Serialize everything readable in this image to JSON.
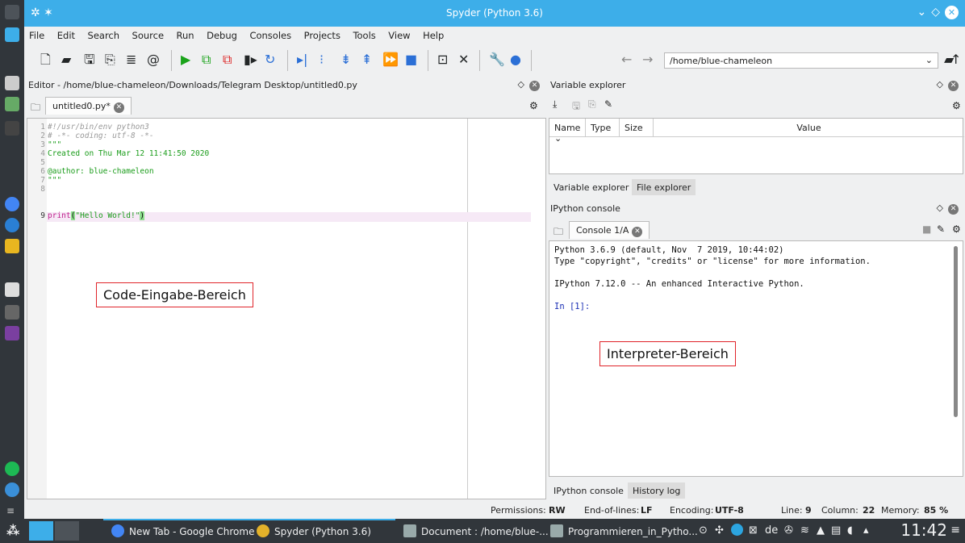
{
  "window": {
    "title": "Spyder (Python 3.6)"
  },
  "menu": [
    "File",
    "Edit",
    "Search",
    "Source",
    "Run",
    "Debug",
    "Consoles",
    "Projects",
    "Tools",
    "View",
    "Help"
  ],
  "toolbar": {
    "path": "/home/blue-chameleon"
  },
  "editor": {
    "header": "Editor - /home/blue-chameleon/Downloads/Telegram Desktop/untitled0.py",
    "tab": "untitled0.py*",
    "lines": [
      {
        "n": "1",
        "text": "#!/usr/bin/env python3"
      },
      {
        "n": "2",
        "text": "# -*- coding: utf-8 -*-"
      },
      {
        "n": "3",
        "text": "\"\"\""
      },
      {
        "n": "4",
        "text": "Created on Thu Mar 12 11:41:50 2020"
      },
      {
        "n": "5",
        "text": ""
      },
      {
        "n": "6",
        "text": "@author: blue-chameleon"
      },
      {
        "n": "7",
        "text": "\"\"\""
      },
      {
        "n": "8",
        "text": ""
      },
      {
        "n": "9",
        "text": "print(\"Hello World!\")"
      }
    ],
    "annotation": "Code-Eingabe-Bereich"
  },
  "varexp": {
    "header": "Variable explorer",
    "columns": [
      "Name",
      "Type",
      "Size",
      "Value"
    ],
    "tabs": [
      "Variable explorer",
      "File explorer"
    ]
  },
  "console": {
    "header": "IPython console",
    "tab": "Console 1/A",
    "lines": [
      "Python 3.6.9 (default, Nov  7 2019, 10:44:02)",
      "Type \"copyright\", \"credits\" or \"license\" for more information.",
      "",
      "IPython 7.12.0 -- An enhanced Interactive Python.",
      "",
      "In [1]:"
    ],
    "annotation": "Interpreter-Bereich",
    "tabs": [
      "IPython console",
      "History log"
    ]
  },
  "status": {
    "permissions_label": "Permissions:",
    "permissions": "RW",
    "eol_label": "End-of-lines:",
    "eol": "LF",
    "encoding_label": "Encoding:",
    "encoding": "UTF-8",
    "line_label": "Line:",
    "line": "9",
    "column_label": "Column:",
    "column": "22",
    "memory_label": "Memory:",
    "memory": "85 %"
  },
  "taskbar": {
    "tasks": [
      "New Tab - Google Chrome",
      "Spyder (Python 3.6)",
      "Document : /home/blue-...",
      "Programmieren_in_Pytho..."
    ],
    "lang": "de",
    "clock": "11:42"
  },
  "colors": {
    "accent": "#3daee9",
    "annotation_border": "#e0242a",
    "taskbar": "#31363b"
  }
}
